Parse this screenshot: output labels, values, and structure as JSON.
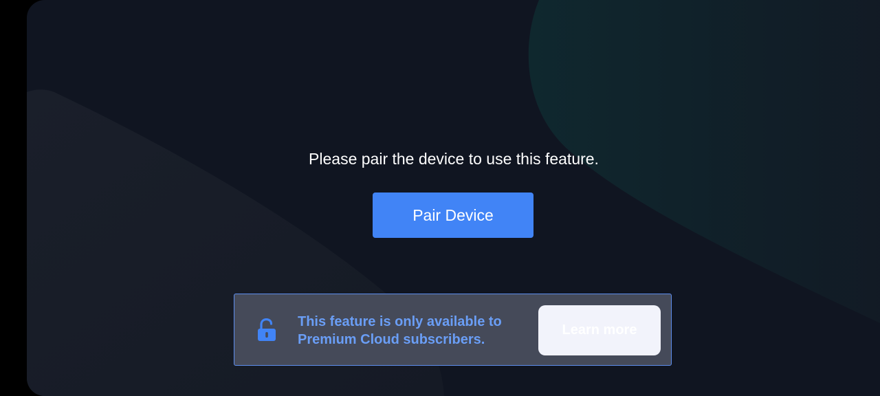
{
  "main": {
    "message": "Please pair the device to use this feature.",
    "pair_button_label": "Pair Device"
  },
  "premium_banner": {
    "icon": "unlocked-padlock-icon",
    "text_line1": "This feature is only available to",
    "text_line2": "Premium Cloud subscribers.",
    "learn_more_label": "Learn more"
  },
  "colors": {
    "background": "#101521",
    "accent": "#4184f6",
    "banner_background": "#454a59",
    "banner_border": "#5e8ff0",
    "banner_text": "#6a9ef6"
  }
}
